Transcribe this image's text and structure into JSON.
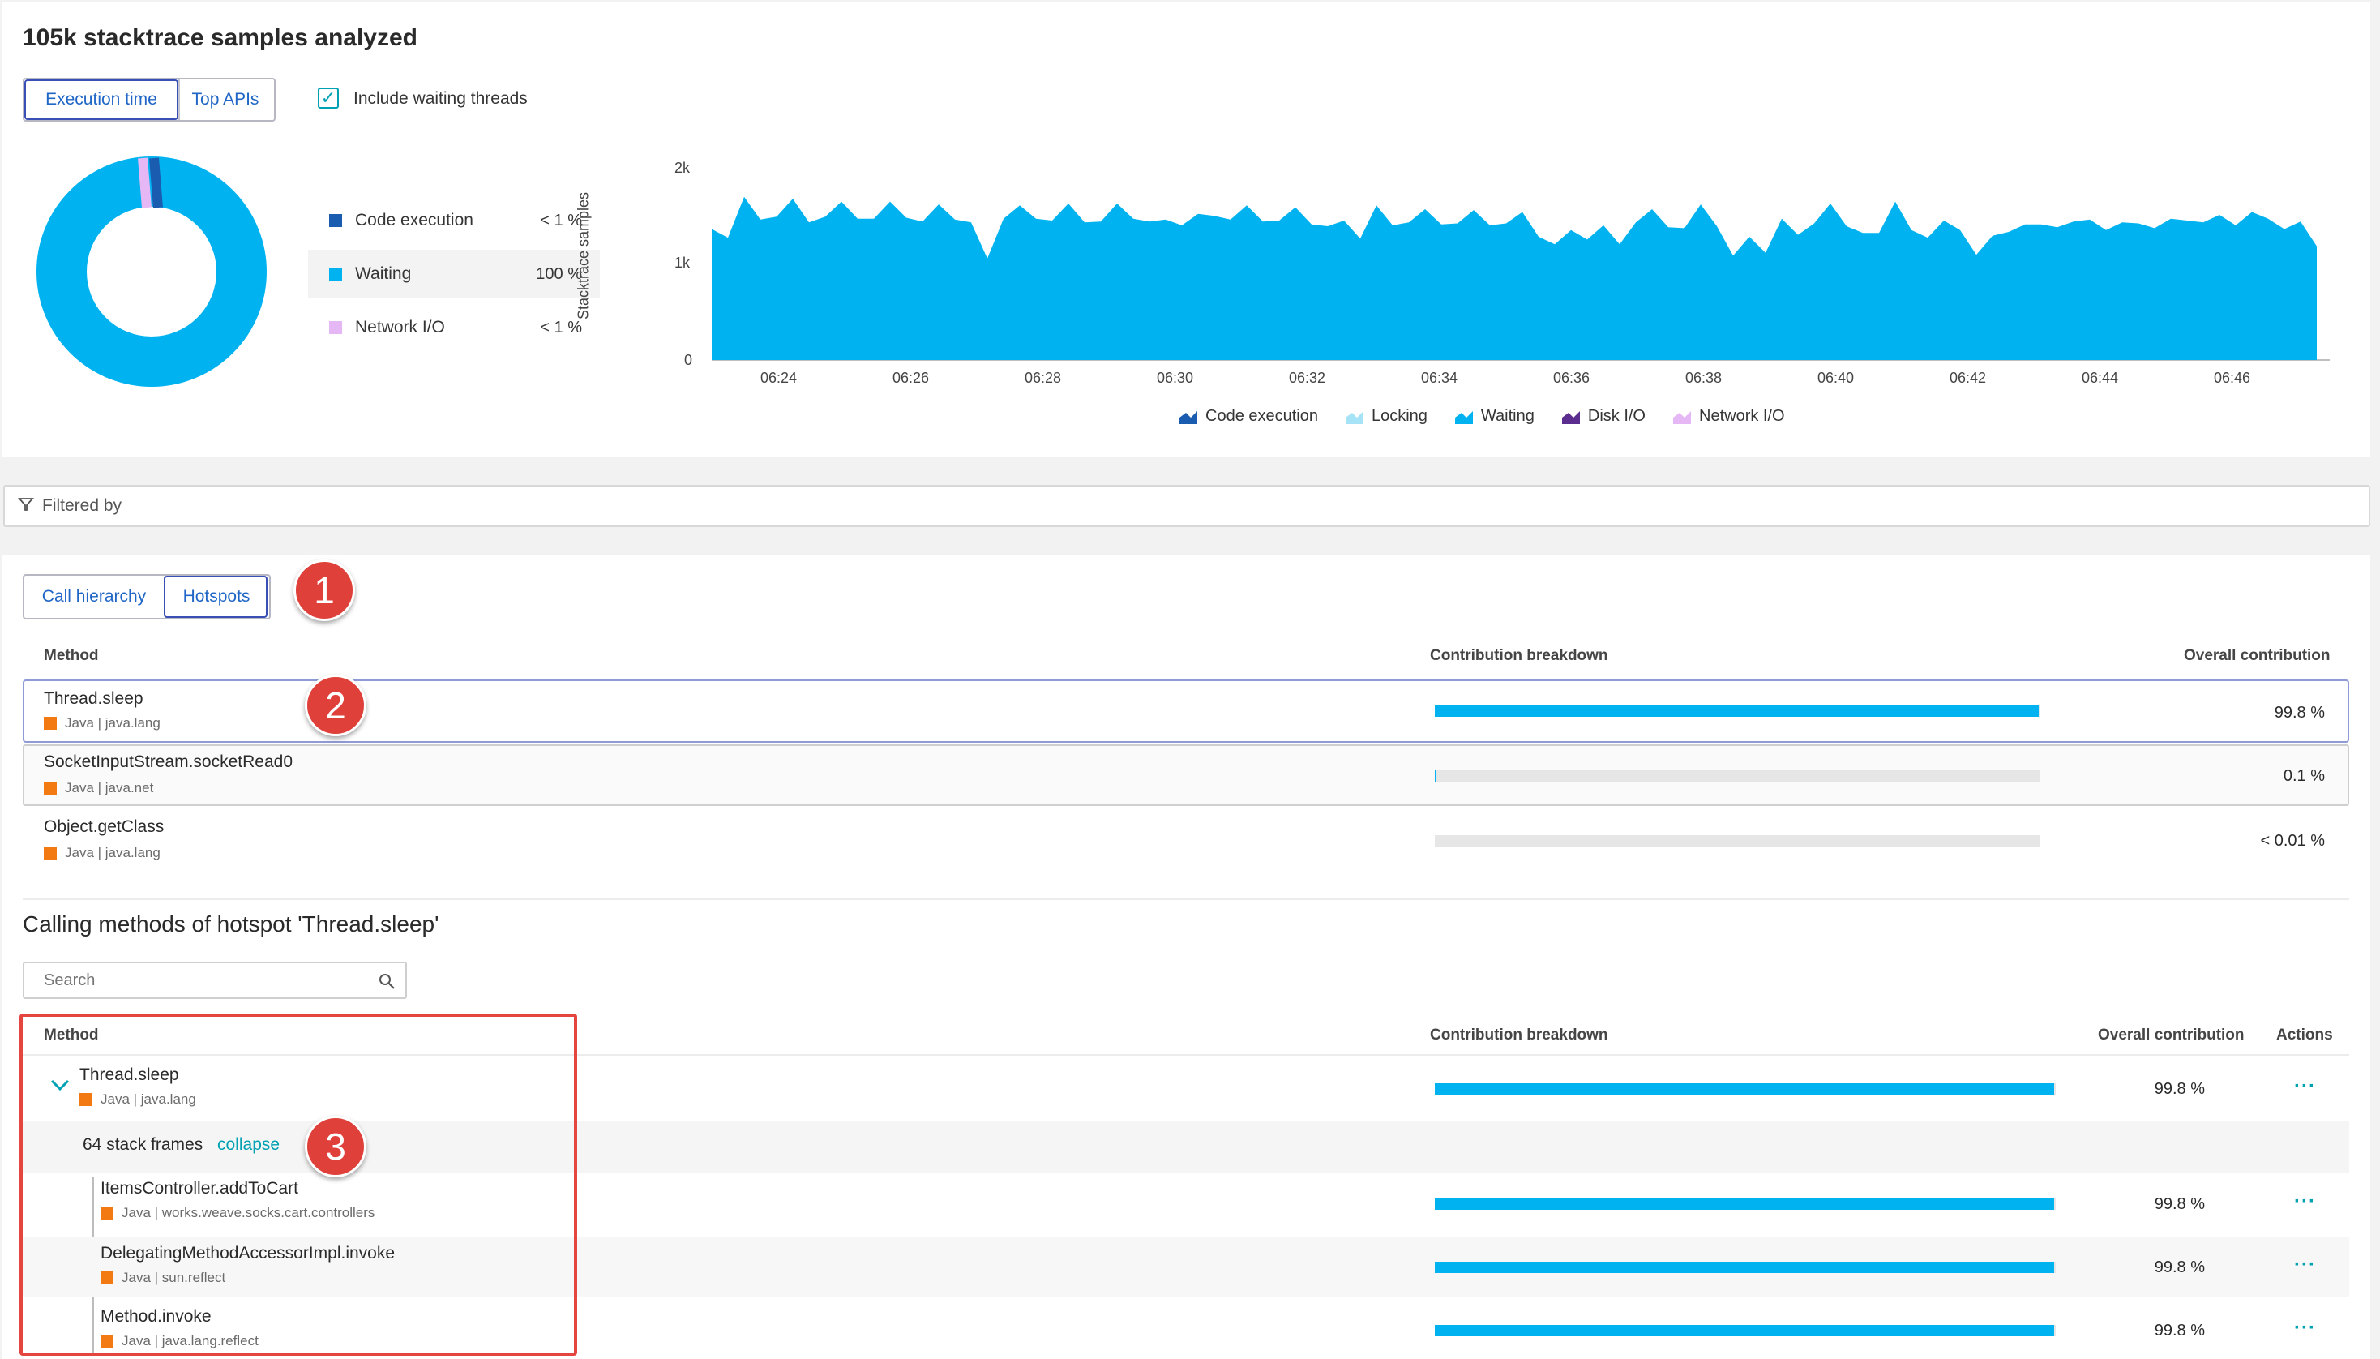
{
  "header": {
    "title": "105k stacktrace samples analyzed",
    "tabs": [
      "Execution time",
      "Top APIs"
    ],
    "include_waiting": "Include waiting threads"
  },
  "donut": {
    "items": [
      {
        "name": "Code execution",
        "pct": "< 1 %",
        "color": "#1a5cb0"
      },
      {
        "name": "Waiting",
        "pct": "100 %",
        "color": "#00b3f0"
      },
      {
        "name": "Network I/O",
        "pct": "< 1 %",
        "color": "#e5b8f5"
      }
    ]
  },
  "chart_data": {
    "type": "area",
    "ylabel": "Stacktrace samples",
    "yticks": [
      "2k",
      "1k",
      "0"
    ],
    "ylim": [
      0,
      2000
    ],
    "xticks": [
      "06:24",
      "06:26",
      "06:28",
      "06:30",
      "06:32",
      "06:34",
      "06:36",
      "06:38",
      "06:40",
      "06:42",
      "06:44",
      "06:46"
    ],
    "legend": [
      {
        "name": "Code execution",
        "color": "#1a5cb0"
      },
      {
        "name": "Locking",
        "color": "#a6e3f7"
      },
      {
        "name": "Waiting",
        "color": "#00b3f0"
      },
      {
        "name": "Disk I/O",
        "color": "#5b2d8e"
      },
      {
        "name": "Network I/O",
        "color": "#e5b8f5"
      }
    ],
    "series": [
      {
        "name": "Waiting",
        "values": [
          1380,
          1290,
          1720,
          1480,
          1510,
          1700,
          1450,
          1510,
          1670,
          1490,
          1490,
          1670,
          1500,
          1460,
          1640,
          1480,
          1450,
          1070,
          1490,
          1630,
          1490,
          1470,
          1650,
          1450,
          1460,
          1650,
          1490,
          1460,
          1480,
          1420,
          1540,
          1520,
          1480,
          1630,
          1460,
          1470,
          1610,
          1430,
          1410,
          1470,
          1280,
          1630,
          1420,
          1450,
          1590,
          1430,
          1440,
          1580,
          1420,
          1440,
          1560,
          1300,
          1220,
          1370,
          1270,
          1420,
          1220,
          1450,
          1590,
          1400,
          1390,
          1640,
          1410,
          1100,
          1300,
          1130,
          1490,
          1320,
          1440,
          1650,
          1410,
          1340,
          1340,
          1670,
          1370,
          1290,
          1470,
          1370,
          1110,
          1310,
          1350,
          1430,
          1430,
          1400,
          1460,
          1480,
          1370,
          1450,
          1440,
          1390,
          1490,
          1470,
          1450,
          1530,
          1420,
          1560,
          1490,
          1380,
          1460,
          1200
        ]
      }
    ]
  },
  "filter": {
    "label": "Filtered by"
  },
  "hotspots": {
    "tabs": [
      "Call hierarchy",
      "Hotspots"
    ],
    "columns": [
      "Method",
      "Contribution breakdown",
      "Overall contribution"
    ],
    "rows": [
      {
        "name": "Thread.sleep",
        "sub": "Java | java.lang",
        "pct": "99.8 %",
        "frac": 0.998
      },
      {
        "name": "SocketInputStream.socketRead0",
        "sub": "Java | java.net",
        "pct": "0.1 %",
        "frac": 0.001
      },
      {
        "name": "Object.getClass",
        "sub": "Java | java.lang",
        "pct": "< 0.01 %",
        "frac": 0.0001
      }
    ]
  },
  "calling": {
    "title": "Calling methods of hotspot 'Thread.sleep'",
    "search_placeholder": "Search",
    "columns": [
      "Method",
      "Contribution breakdown",
      "Overall contribution",
      "Actions"
    ],
    "root": {
      "name": "Thread.sleep",
      "sub": "Java | java.lang",
      "pct": "99.8 %",
      "frac": 0.998
    },
    "frames": {
      "text": "64 stack frames",
      "link": "collapse"
    },
    "rows": [
      {
        "name": "ItemsController.addToCart",
        "sub": "Java | works.weave.socks.cart.controllers",
        "pct": "99.8 %",
        "frac": 0.998
      },
      {
        "name": "DelegatingMethodAccessorImpl.invoke",
        "sub": "Java | sun.reflect",
        "pct": "99.8 %",
        "frac": 0.998
      },
      {
        "name": "Method.invoke",
        "sub": "Java | java.lang.reflect",
        "pct": "99.8 %",
        "frac": 0.998
      }
    ],
    "actions_icon": "···"
  },
  "badges": [
    "1",
    "2",
    "3"
  ]
}
